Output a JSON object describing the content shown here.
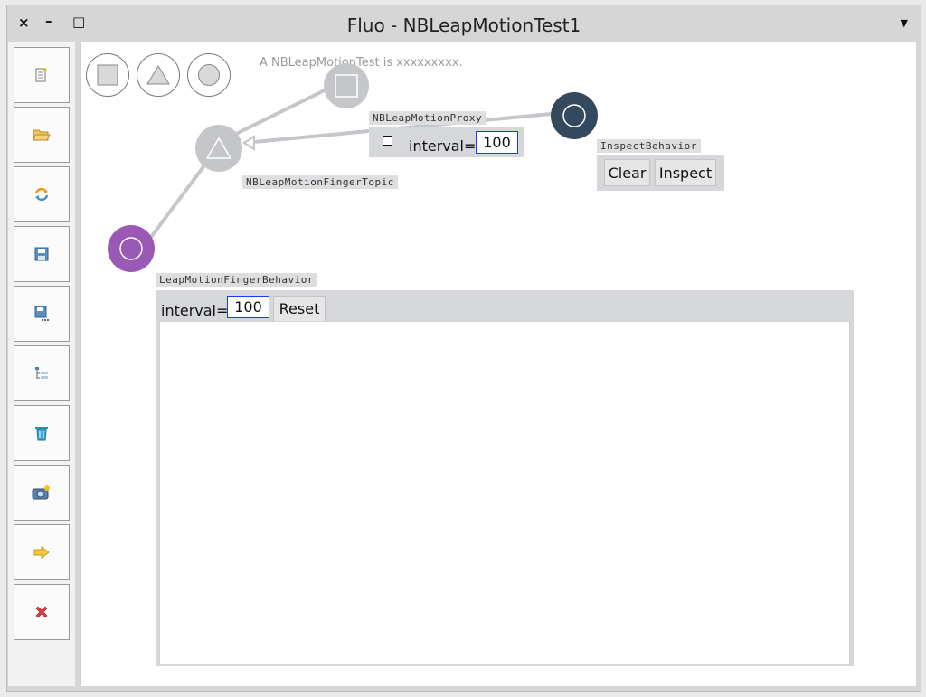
{
  "window": {
    "title": "Fluo - NBLeapMotionTest1",
    "close_glyph": "×",
    "minimize_glyph": "–",
    "maximize_glyph": "□",
    "menu_glyph": "▼"
  },
  "toolbar": {
    "icons": [
      "new-file-icon",
      "open-folder-icon",
      "refresh-icon",
      "save-icon",
      "save-as-icon",
      "tree-list-icon",
      "trash-icon",
      "camera-icon",
      "arrow-right-icon",
      "delete-x-icon"
    ]
  },
  "canvas": {
    "description": "A NBLeapMotionTest is xxxxxxxxx.",
    "palette": [
      "square-shape-icon",
      "triangle-shape-icon",
      "circle-shape-icon"
    ],
    "proxy": {
      "tag": "NBLeapMotionProxy",
      "interval_label": "interval=",
      "interval_value": "100"
    },
    "finger_topic": {
      "tag": "NBLeapMotionFingerTopic"
    },
    "inspect_behavior": {
      "tag": "InspectBehavior",
      "clear_label": "Clear",
      "inspect_label": "Inspect"
    },
    "finger_behavior": {
      "tag": "LeapMotionFingerBehavior",
      "interval_label": "interval=",
      "interval_value": "100",
      "reset_label": "Reset"
    }
  },
  "colors": {
    "node_gray": "#c4c6c9",
    "node_dark": "#34495e",
    "node_purple": "#9b59b6",
    "field_border": "#1a3cf0"
  }
}
